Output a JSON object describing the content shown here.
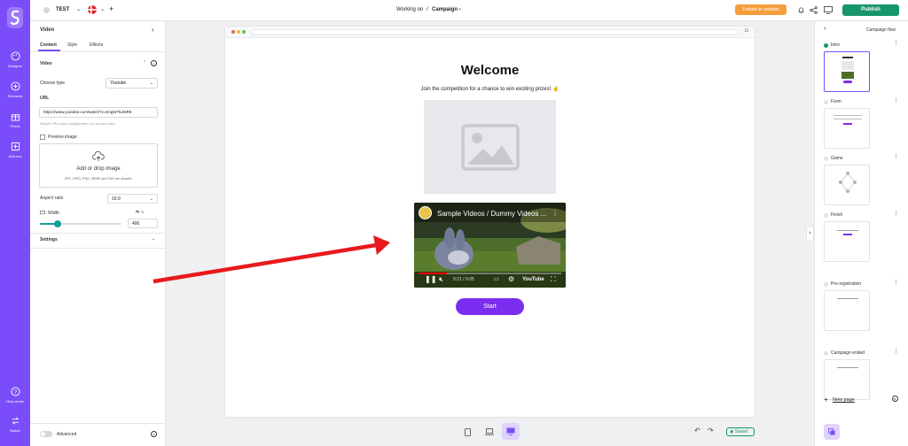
{
  "nav": {
    "items": [
      {
        "label": "Designer"
      },
      {
        "label": "Elements"
      },
      {
        "label": "Prizes"
      },
      {
        "label": "Add-ons"
      }
    ],
    "bottom": [
      {
        "label": "Help center"
      },
      {
        "label": "Switch"
      }
    ]
  },
  "topbar": {
    "project_name": "TEST",
    "working_on": "Working on",
    "separator": "/",
    "campaign": "Campaign",
    "embed_label": "Embed on website",
    "publish_label": "Publish"
  },
  "panel": {
    "title": "Video",
    "tabs": [
      "Content",
      "Style",
      "Effects"
    ],
    "section_video": "Video",
    "choose_type_label": "Choose type",
    "choose_type_value": "Youtube",
    "url_label": "URL",
    "url_value": "https://www.youtube.com/watch?v=EngW7tLk6R8",
    "url_hint": "Sample URLs stop changing when you set your video",
    "preview_label": "Preview image",
    "upload_title": "Add or drop image",
    "upload_hint": "JPG, JPEG, PNG, WEBP and SVG are allowed.",
    "aspect_label": "Aspect ratio",
    "aspect_value": "16:9",
    "width_label": "Width",
    "width_value": "400",
    "width_slider_fraction": 0.22,
    "settings_label": "Settings",
    "advanced_label": "Advanced"
  },
  "canvas": {
    "heading": "Welcome",
    "subheading": "Join the competition for a chance to win exciting prizes! ✌",
    "video_title": "Sample Videos / Dummy Videos ...",
    "video_time": "0:21 / 0:05",
    "video_brand": "YouTube",
    "video_progress_fraction": 0.2,
    "start_label": "Start"
  },
  "right": {
    "title": "Campaign flow",
    "pages": [
      "Intro",
      "Form",
      "Game",
      "Finish",
      "Pre-registration",
      "Campaign ended"
    ],
    "new_page_label": "New page"
  },
  "bottom": {
    "saved_label": "Saved"
  },
  "colors": {
    "brand": "#7b4dfa",
    "publish": "#17966c",
    "embed": "#f59e3b",
    "arrow": "#e8191c"
  }
}
